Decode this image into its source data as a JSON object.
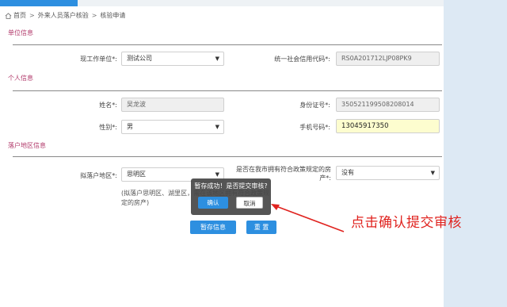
{
  "topbar": {
    "tabs": [
      "",
      "",
      ""
    ],
    "accent": "#2d8fe0"
  },
  "breadcrumb": {
    "home": "首页",
    "level2": "外来人员落户核验",
    "level3": "核验申请",
    "separator": ">"
  },
  "sections": {
    "employer": "单位信息",
    "personal": "个人信息",
    "area": "落户地区信息"
  },
  "employer": {
    "unit_label": "现工作单位",
    "unit_value": "测试公司",
    "credit_code_label": "统一社会信用代码",
    "credit_code_value": "RS0A201712LJP08PK9"
  },
  "personal": {
    "name_label": "姓名",
    "name_value": "吴龙波",
    "id_label": "身份证号",
    "id_value": "350521199508208014",
    "gender_label": "性别",
    "gender_value": "男",
    "phone_label": "手机号码",
    "phone_value": "13045917350"
  },
  "area": {
    "district_label": "拟落户地区",
    "district_value": "思明区",
    "housing_label_line1": "是否在我市拥有符合政策规定的房",
    "housing_label_line2": "产",
    "housing_value": "没有",
    "hint": "(拟落户思明区、湖里区，需在该地区拥有符合政策规定的房产)"
  },
  "required_mark": "*:",
  "modal": {
    "message": "暂存成功！是否提交审核?",
    "confirm": "确认",
    "cancel": "取消"
  },
  "actions": {
    "save": "暂存信息",
    "reset": "重 置"
  },
  "annotation": {
    "text": "点击确认提交审核",
    "color": "#e0231f"
  },
  "colors": {
    "section_title": "#b23a6b",
    "primary": "#2d8fe0",
    "phone_highlight": "#fdfdcf",
    "side_panel": "#dde9f4"
  }
}
